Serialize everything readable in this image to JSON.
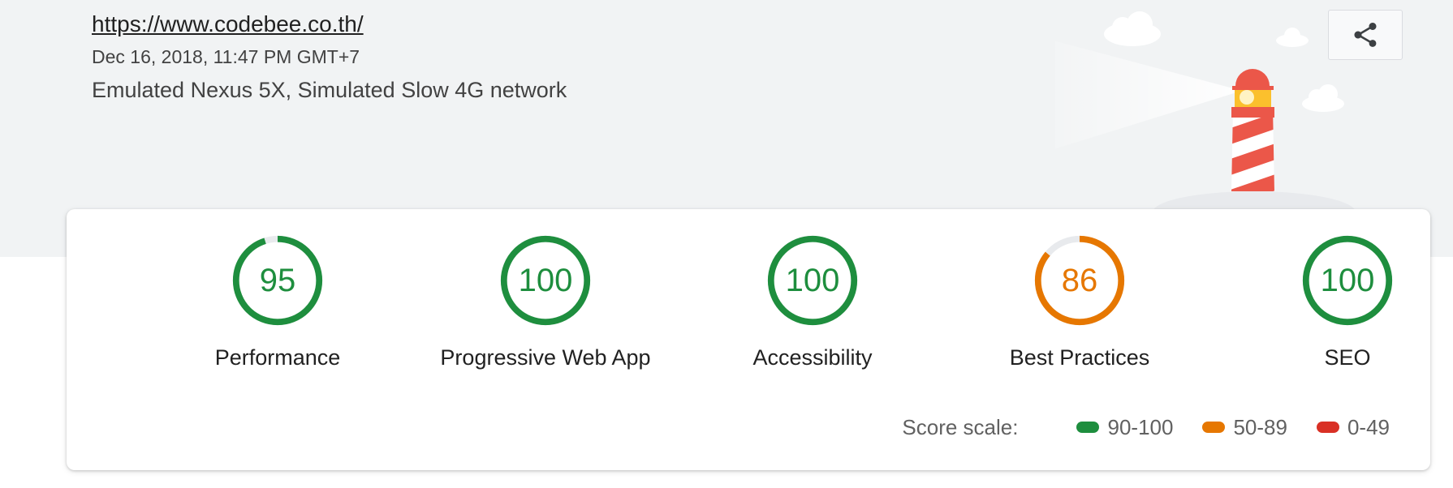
{
  "header": {
    "url": "https://www.codebee.co.th/",
    "timestamp": "Dec 16, 2018, 11:47 PM GMT+7",
    "environment": "Emulated Nexus 5X, Simulated Slow 4G network",
    "share_icon": "share-icon"
  },
  "colors": {
    "pass": "#1e8e3e",
    "average": "#e67700",
    "fail": "#d93025",
    "track": "#e8eaed",
    "header_bg": "#f1f3f4"
  },
  "gauges": [
    {
      "score": "95",
      "value": 95,
      "label": "Performance",
      "status": "pass"
    },
    {
      "score": "100",
      "value": 100,
      "label": "Progressive Web App",
      "status": "pass"
    },
    {
      "score": "100",
      "value": 100,
      "label": "Accessibility",
      "status": "pass"
    },
    {
      "score": "86",
      "value": 86,
      "label": "Best Practices",
      "status": "average"
    },
    {
      "score": "100",
      "value": 100,
      "label": "SEO",
      "status": "pass"
    }
  ],
  "score_scale": {
    "title": "Score scale:",
    "ranges": [
      {
        "label": "90-100",
        "status": "pass"
      },
      {
        "label": "50-89",
        "status": "average"
      },
      {
        "label": "0-49",
        "status": "fail"
      }
    ]
  }
}
